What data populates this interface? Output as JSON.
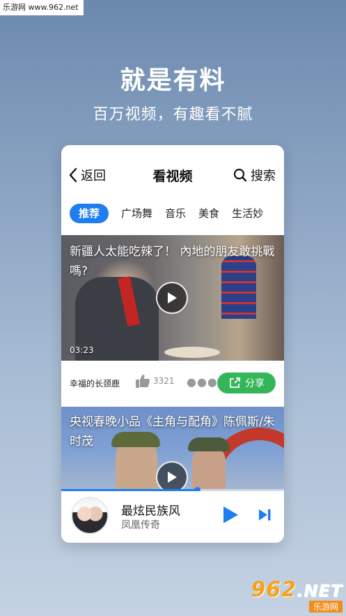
{
  "watermark_top": "乐游网 www.962.net",
  "promo": {
    "headline": "就是有料",
    "subline": "百万视频，有趣看不腻"
  },
  "nav": {
    "back_label": "返回",
    "title": "看视频",
    "search_label": "搜索"
  },
  "tabs": [
    {
      "label": "推荐",
      "active": true
    },
    {
      "label": "广场舞",
      "active": false
    },
    {
      "label": "音乐",
      "active": false
    },
    {
      "label": "美食",
      "active": false
    },
    {
      "label": "生活妙",
      "active": false
    }
  ],
  "videos": [
    {
      "title": "新疆人太能吃辣了！ 內地的朋友敢挑戰嗎?",
      "duration": "03:23",
      "author": "幸福的长颈鹿",
      "likes": "3321",
      "share_label": "分享"
    },
    {
      "title": "央视春晚小品《主角与配角》陈佩斯/朱时茂"
    }
  ],
  "player": {
    "song_title": "最炫民族风",
    "artist": "凤凰传奇",
    "progress": 0.61
  },
  "brand": {
    "logo_number": "962",
    "logo_suffix": ".NET",
    "logo_cn": "乐游网"
  },
  "colors": {
    "accent": "#1e7ef0",
    "share_green": "#35b55a",
    "background_top": "#6b89ad"
  }
}
